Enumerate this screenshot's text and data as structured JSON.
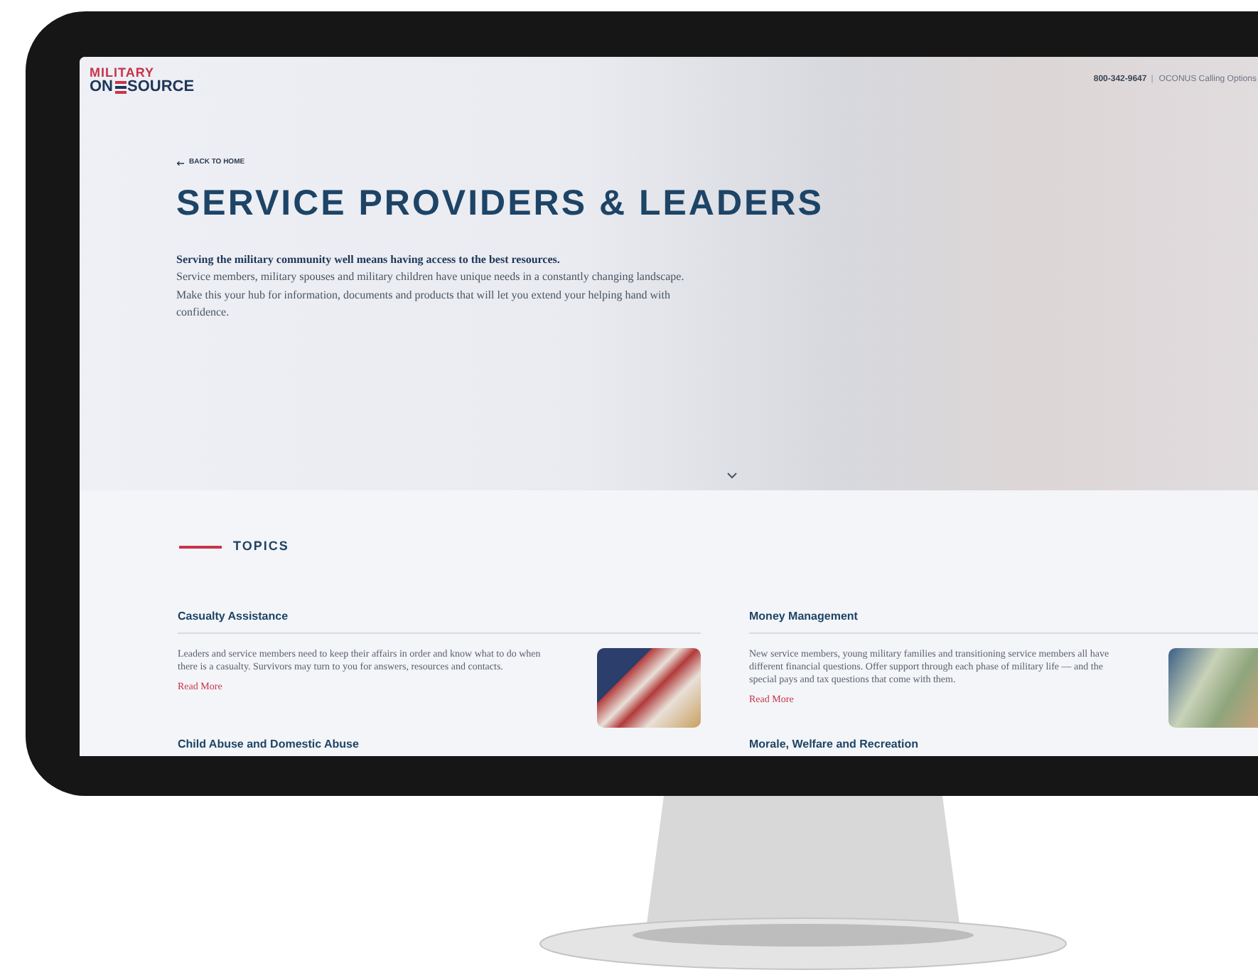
{
  "logo": {
    "top": "MILITARY",
    "bottom_start": "ON",
    "bottom_end": "SOURCE"
  },
  "header": {
    "phone": "800-342-9647",
    "separator": "|",
    "link": "OCONUS Calling Options"
  },
  "hero": {
    "back_link": "BACK TO HOME",
    "title": "SERVICE PROVIDERS & LEADERS",
    "lead": "Serving the military community well means having access to the best resources.",
    "body": "Service members, military spouses and military children have unique needs in a constantly changing landscape. Make this your hub for information, documents and products that will let you extend your helping hand with confidence."
  },
  "topics": {
    "heading": "TOPICS",
    "items": [
      {
        "title": "Casualty Assistance",
        "text": "Leaders and service members need to keep their affairs in order and know what to do when there is a casualty. Survivors may turn to you for answers, resources and contacts.",
        "link": "Read More",
        "kind": "flag"
      },
      {
        "title": "Money Management",
        "text": "New service members, young military families and transitioning service members all have different financial questions. Offer support through each phase of military life — and the special pays and tax questions that come with them.",
        "link": "Read More",
        "kind": "money"
      },
      {
        "title": "Child Abuse and Domestic Abuse"
      },
      {
        "title": "Morale, Welfare and Recreation"
      }
    ]
  }
}
